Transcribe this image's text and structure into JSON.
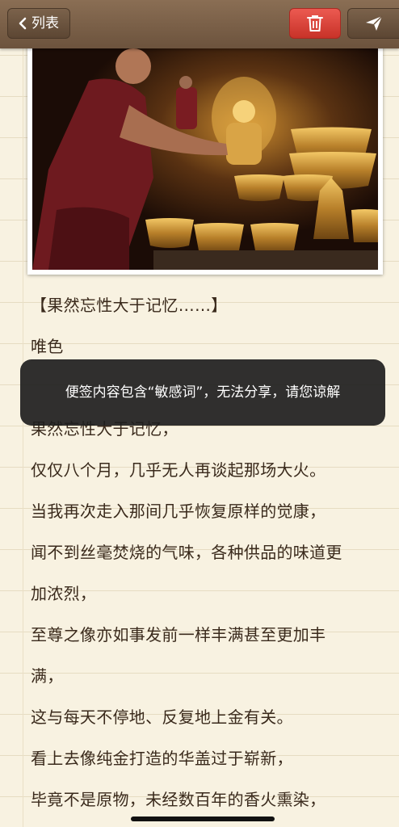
{
  "nav": {
    "back_label": "列表",
    "back_icon": "chevron-left-icon",
    "delete_icon": "trash-icon",
    "share_icon": "paper-plane-icon",
    "delete_color": "#e2473e"
  },
  "photo": {
    "description_icon": "photo"
  },
  "note": {
    "lines": [
      "【果然忘性大于记忆……】",
      "唯色",
      "",
      "果然忘性大于记忆，",
      "仅仅八个月，几乎无人再谈起那场大火。",
      "当我再次走入那间几乎恢复原样的觉康，",
      "闻不到丝毫焚烧的气味，各种供品的味道更",
      "加浓烈，",
      "至尊之像亦如事发前一样丰满甚至更加丰",
      "满，",
      "这与每天不停地、反复地上金有关。",
      "看上去像纯金打造的华盖过于崭新，",
      "毕竟不是原物，未经数百年的香火熏染，"
    ]
  },
  "toast": {
    "message": "便签内容包含“敏感词”，无法分享，请您谅解"
  }
}
